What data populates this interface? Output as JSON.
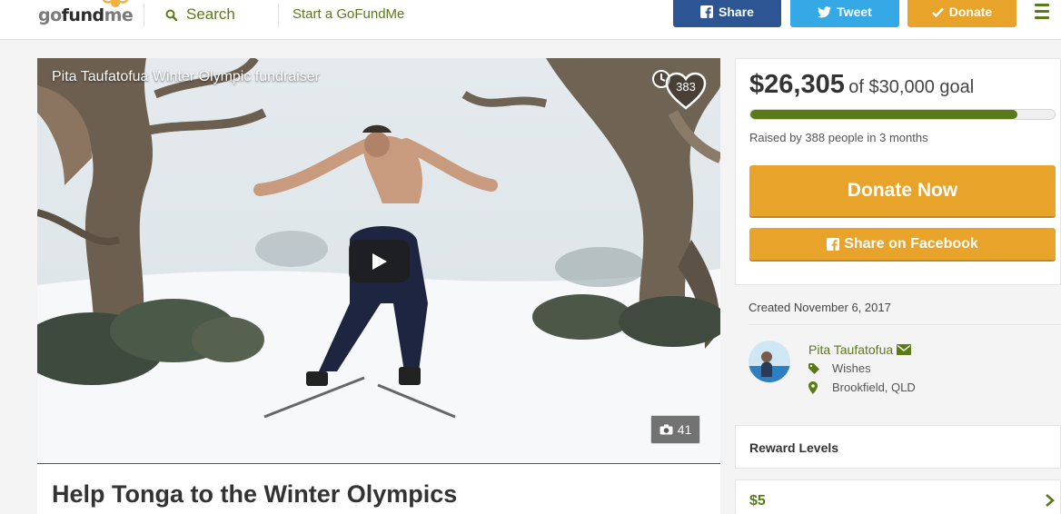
{
  "header": {
    "logo": {
      "part1": "go",
      "part2": "fund",
      "part3": "me"
    },
    "search_label": "Search",
    "start_label": "Start a GoFundMe",
    "share_label": "Share",
    "tweet_label": "Tweet",
    "donate_label": "Donate"
  },
  "video": {
    "title": "Pita Taufatofua Winter Olympic fundraiser",
    "heart_count": "383",
    "photo_count": "41"
  },
  "campaign": {
    "title": "Help Tonga to the Winter Olympics"
  },
  "donation": {
    "amount": "$26,305",
    "goal_text": "of $30,000 goal",
    "progress_fraction": 0.877,
    "raised_text": "Raised by 388 people in 3 months",
    "donate_now_label": "Donate Now",
    "share_facebook_label": "Share on Facebook"
  },
  "organizer": {
    "created": "Created November 6, 2017",
    "name": "Pita Taufatofua",
    "category": "Wishes",
    "location": "Brookfield, QLD"
  },
  "rewards": {
    "heading": "Reward Levels",
    "first_amount": "$5"
  },
  "colors": {
    "brand_green": "#5a7a18",
    "donate_orange": "#e8a32b",
    "facebook_blue": "#2e5593",
    "twitter_blue": "#35a9e6"
  }
}
